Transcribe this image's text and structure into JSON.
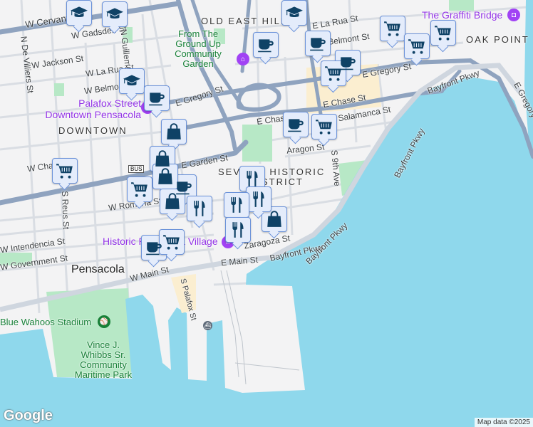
{
  "map": {
    "neighborhoods": [
      "OLD EAST HILL",
      "DOWNTOWN",
      "OAK POINT",
      "SEVILLE HISTORIC",
      "DISTRICT"
    ],
    "city": "Pensacola",
    "streets": [
      "W Cervantes St",
      "W Gadsden St",
      "N Guillemard St",
      "N De Villiers St",
      "W Jackson St",
      "W La Rua St",
      "W Belmont St",
      "E Gregory St",
      "E Chase St",
      "W Chase St",
      "E Garden St",
      "S Reus St",
      "W Romana St",
      "W Intendencia St",
      "W Government St",
      "W Main St",
      "E Main St",
      "S Palafox St",
      "Zaragoza St",
      "Bayfront Pkwy",
      "Aragon St",
      "S 9th Ave",
      "Salamanca St",
      "E La Rua St",
      "Belmont St",
      "E Gregory St",
      "Bayfront Pkwy",
      "Bayfront Pkwy",
      "Romana St",
      "E Chase St"
    ],
    "pois": {
      "palafox": "Palafox Street Downtown Pensacola",
      "garden": "From The Ground Up Community Garden",
      "graffiti": "The Graffiti Bridge",
      "historic": "Historic Pensacola Village",
      "stadium": "Blue Wahoos Stadium",
      "park": "Vince J. Whibbs Sr. Community Maritime Park"
    },
    "shield": "BUS"
  },
  "markers": [
    "school",
    "school",
    "school",
    "school",
    "coffee",
    "coffee",
    "coffee",
    "coffee",
    "coffee",
    "coffee",
    "coffee",
    "grocery",
    "grocery",
    "grocery",
    "grocery",
    "grocery",
    "grocery",
    "grocery",
    "grocery",
    "shopping",
    "shopping",
    "shopping",
    "shopping",
    "shopping",
    "restaurant",
    "restaurant",
    "restaurant",
    "restaurant",
    "restaurant"
  ],
  "footer": {
    "logo": "Google",
    "credit": "Map data ©2025"
  },
  "colors": {
    "water": "#8fd8ec",
    "land": "#f3f3f4",
    "park": "#b7e8c6",
    "arterial": "#8fa3bf",
    "marker_bg": "#e4ecfb",
    "marker_icon": "#0f4266"
  }
}
